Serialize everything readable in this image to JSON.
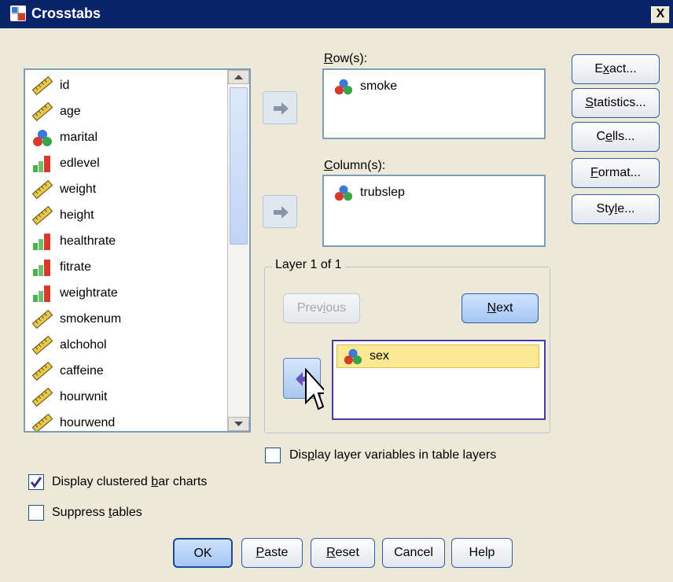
{
  "window": {
    "title": "Crosstabs",
    "close_label": "X"
  },
  "variables": [
    {
      "name": "id",
      "icon": "ruler-scale-icon"
    },
    {
      "name": "age",
      "icon": "ruler-scale-icon"
    },
    {
      "name": "marital",
      "icon": "nominal-balls-icon"
    },
    {
      "name": "edlevel",
      "icon": "ordinal-bars-icon"
    },
    {
      "name": "weight",
      "icon": "ruler-scale-icon"
    },
    {
      "name": "height",
      "icon": "ruler-scale-icon"
    },
    {
      "name": "healthrate",
      "icon": "ordinal-bars-icon"
    },
    {
      "name": "fitrate",
      "icon": "ordinal-bars-icon"
    },
    {
      "name": "weightrate",
      "icon": "ordinal-bars-icon"
    },
    {
      "name": "smokenum",
      "icon": "ruler-scale-icon"
    },
    {
      "name": "alchohol",
      "icon": "ruler-scale-icon"
    },
    {
      "name": "caffeine",
      "icon": "ruler-scale-icon"
    },
    {
      "name": "hourwnit",
      "icon": "ruler-scale-icon"
    },
    {
      "name": "hourwend",
      "icon": "ruler-scale-icon"
    }
  ],
  "rows": {
    "label_prefix": "R",
    "label_rest": "ow(s):",
    "items": [
      "smoke"
    ]
  },
  "columns": {
    "label_prefix": "C",
    "label_rest": "olumn(s):",
    "items": [
      "trubslep"
    ]
  },
  "layer": {
    "legend": "Layer 1 of 1",
    "previous_label_a": "Prev",
    "previous_label_u": "i",
    "previous_label_b": "ous",
    "next_label_u": "N",
    "next_label_rest": "ext",
    "items": [
      "sex"
    ]
  },
  "side_buttons": {
    "exact_a": "E",
    "exact_u": "x",
    "exact_b": "act...",
    "statistics_u": "S",
    "statistics_rest": "tatistics...",
    "cells_a": "C",
    "cells_u": "e",
    "cells_b": "lls...",
    "format_u": "F",
    "format_rest": "ormat...",
    "style_a": "Sty",
    "style_u": "l",
    "style_b": "e..."
  },
  "checkboxes": {
    "display_layer_a": "Dis",
    "display_layer_u": "p",
    "display_layer_b": "lay layer variables in table layers",
    "display_layer_checked": false,
    "clustered_a": "Display clustered ",
    "clustered_u": "b",
    "clustered_b": "ar charts",
    "clustered_checked": true,
    "suppress_a": "Suppress ",
    "suppress_u": "t",
    "suppress_b": "ables",
    "suppress_checked": false
  },
  "bottom_buttons": {
    "ok": "OK",
    "paste_u": "P",
    "paste_rest": "aste",
    "reset_u": "R",
    "reset_rest": "eset",
    "cancel": "Cancel",
    "help": "Help"
  },
  "colors": {
    "titlebar": "#0a246a",
    "accent_border": "#2e5ea8",
    "selection": "#fbe892",
    "check": "#3b2f8f"
  }
}
